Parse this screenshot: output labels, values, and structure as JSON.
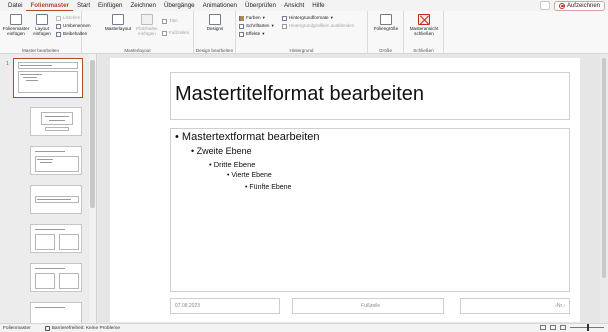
{
  "menu": {
    "tabs": [
      "Datei",
      "Folienmaster",
      "Start",
      "Einfügen",
      "Zeichnen",
      "Übergänge",
      "Animationen",
      "Überprüfen",
      "Ansicht",
      "Hilfe"
    ],
    "record_label": "Aufzeichnen"
  },
  "ribbon": {
    "master_edit": {
      "insert_master": "Folienmaster einfügen",
      "insert_layout": "Layout einfügen",
      "delete": "Löschen",
      "rename": "Umbenennen",
      "keep": "Beibehalten",
      "group_label": "Master bearbeiten"
    },
    "master_layout": {
      "masterlayout": "Masterlayout",
      "placeholder": "Platzhalter einfügen",
      "title": "Titel",
      "footers": "Fußzeilen",
      "group_label": "Masterlayout"
    },
    "design": {
      "designs": "Designs",
      "group_label": "Design bearbeiten"
    },
    "background": {
      "colors": "Farben",
      "fonts": "Schriftarten",
      "effects": "Effekte",
      "bg_styles": "Hintergrundformate",
      "hide_bg": "Hintergrundgrafiken ausblenden",
      "group_label": "Hintergrund"
    },
    "size": {
      "slide_size": "Foliengröße",
      "group_label": "Größe"
    },
    "close": {
      "close_master": "Masteransicht schließen",
      "group_label": "Schließen"
    }
  },
  "thumbnails": {
    "selected_number": "1",
    "master_title": "Mastertitelformat bearbeiten",
    "layout2_title": "Mastertitelformat bearbeiten"
  },
  "slide": {
    "title": "Mastertitelformat bearbeiten",
    "bullets": [
      "Mastertextformat bearbeiten",
      "Zweite Ebene",
      "Dritte Ebene",
      "Vierte Ebene",
      "Fünfte Ebene"
    ],
    "footer_date": "07.08.2023",
    "footer_text": "Fußzeile",
    "footer_num": "‹Nr.›"
  },
  "status": {
    "view": "Folienmaster",
    "accessibility": "Barrierefreiheit: Keine Probleme"
  },
  "colors": {
    "accent": "#b7472a",
    "record_red": "#c42b1c"
  }
}
